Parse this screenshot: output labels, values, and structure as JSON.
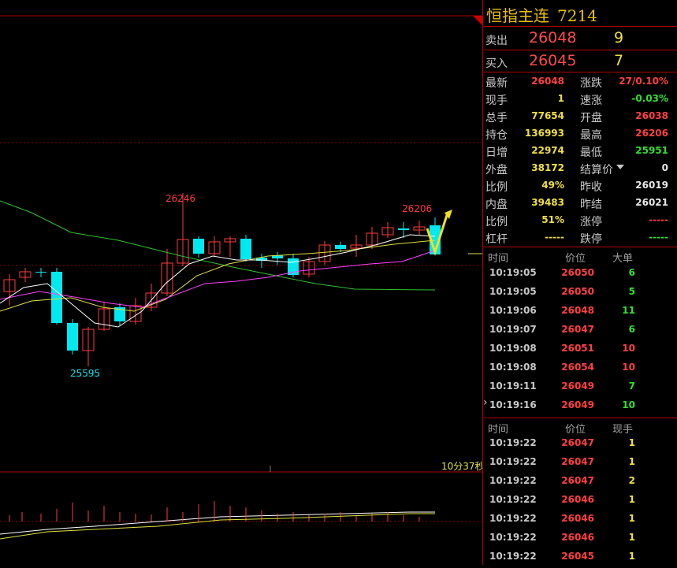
{
  "instrument": {
    "name": "恒指主连",
    "code": "7214"
  },
  "quote": {
    "sell": {
      "label": "卖出",
      "price": "26048",
      "volume": "9"
    },
    "buy": {
      "label": "买入",
      "price": "26045",
      "volume": "7"
    }
  },
  "stats_left": [
    {
      "label": "最新",
      "value": "26048",
      "color": "#ff4040"
    },
    {
      "label": "现手",
      "value": "1",
      "color": "#f0e040"
    },
    {
      "label": "总手",
      "value": "77654",
      "color": "#f0e040"
    },
    {
      "label": "持仓",
      "value": "136993",
      "color": "#f0e040"
    },
    {
      "label": "日增",
      "value": "22974",
      "color": "#f0e040"
    },
    {
      "label": "外盘",
      "value": "38172",
      "color": "#f0e040"
    },
    {
      "label": "比例",
      "value": "49%",
      "color": "#f0e040"
    },
    {
      "label": "内盘",
      "value": "39483",
      "color": "#f0e040"
    },
    {
      "label": "比例",
      "value": "51%",
      "color": "#f0e040"
    },
    {
      "label": "杠杆",
      "value": "-----",
      "color": "#f0e040"
    }
  ],
  "stats_right": [
    {
      "label": "涨跌",
      "value": "27/0.10%",
      "color": "#ff4040"
    },
    {
      "label": "速涨",
      "value": "-0.03%",
      "color": "#30e030"
    },
    {
      "label": "开盘",
      "value": "26038",
      "color": "#ff4040"
    },
    {
      "label": "最高",
      "value": "26206",
      "color": "#ff4040"
    },
    {
      "label": "最低",
      "value": "25951",
      "color": "#30e030"
    },
    {
      "label": "结算价",
      "value": "0",
      "color": "#e8e8e8"
    },
    {
      "label": "昨收",
      "value": "26019",
      "color": "#e8e8e8"
    },
    {
      "label": "昨结",
      "value": "26021",
      "color": "#e8e8e8"
    },
    {
      "label": "涨停",
      "value": "-----",
      "color": "#ff4040"
    },
    {
      "label": "跌停",
      "value": "-----",
      "color": "#30e030"
    }
  ],
  "big_trades": {
    "headers": [
      "时间",
      "价位",
      "大单"
    ],
    "rows": [
      {
        "time": "10:19:05",
        "price": "26050",
        "qty": "6",
        "color": "#30e030"
      },
      {
        "time": "10:19:05",
        "price": "26050",
        "qty": "5",
        "color": "#30e030"
      },
      {
        "time": "10:19:06",
        "price": "26048",
        "qty": "11",
        "color": "#30e030"
      },
      {
        "time": "10:19:07",
        "price": "26047",
        "qty": "6",
        "color": "#30e030"
      },
      {
        "time": "10:19:08",
        "price": "26051",
        "qty": "10",
        "color": "#ff4040"
      },
      {
        "time": "10:19:08",
        "price": "26054",
        "qty": "10",
        "color": "#ff4040"
      },
      {
        "time": "10:19:11",
        "price": "26049",
        "qty": "7",
        "color": "#30e030"
      },
      {
        "time": "10:19:16",
        "price": "26049",
        "qty": "10",
        "color": "#30e030"
      }
    ]
  },
  "ticks": {
    "headers": [
      "时间",
      "价位",
      "现手"
    ],
    "rows": [
      {
        "time": "10:19:22",
        "price": "26047",
        "qty": "1",
        "color": "#f0e040"
      },
      {
        "time": "10:19:22",
        "price": "26047",
        "qty": "1",
        "color": "#f0e040"
      },
      {
        "time": "10:19:22",
        "price": "26047",
        "qty": "2",
        "color": "#f0e040"
      },
      {
        "time": "10:19:22",
        "price": "26046",
        "qty": "1",
        "color": "#f0e040"
      },
      {
        "time": "10:19:22",
        "price": "26046",
        "qty": "1",
        "color": "#f0e040"
      },
      {
        "time": "10:19:22",
        "price": "26046",
        "qty": "1",
        "color": "#f0e040"
      },
      {
        "time": "10:19:22",
        "price": "26045",
        "qty": "1",
        "color": "#f0e040"
      }
    ]
  },
  "chart": {
    "high_label": "26246",
    "low_label": "25595",
    "recent_high_label": "26206",
    "countdown": "10分37秒",
    "colors": {
      "up": "#ff3c3c",
      "down": "#00e8f0",
      "ma_white": "#ffffff",
      "ma_yellow": "#e0e040",
      "ma_magenta": "#ff40ff",
      "ma_green": "#30c030"
    }
  }
}
